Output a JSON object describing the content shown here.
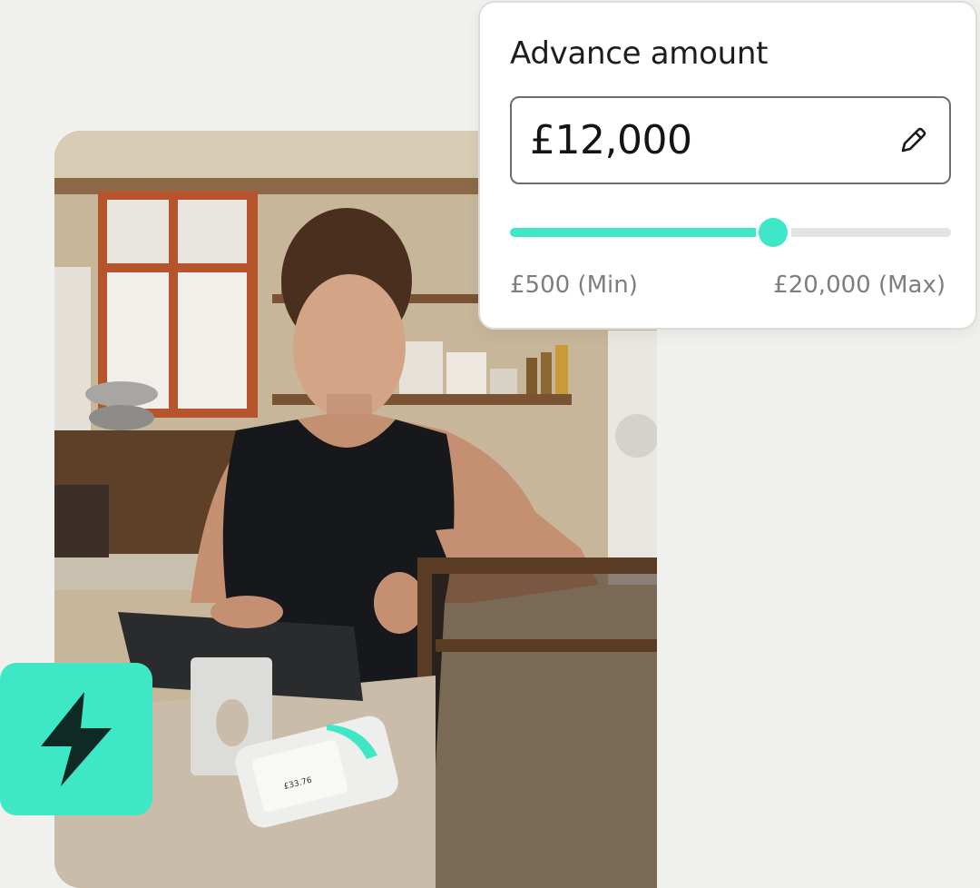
{
  "advance": {
    "title": "Advance amount",
    "amount": "£12,000",
    "min_label": "£500 (Min)",
    "max_label": "£20,000 (Max)",
    "slider_fraction": 0.58
  },
  "terminal": {
    "amount": "£33.76"
  },
  "colors": {
    "accent": "#3ee7c5",
    "icon_dark": "#0f2a24",
    "background": "#f0f0ec"
  },
  "icons": {
    "badge": "lightning-bolt-icon",
    "edit": "pencil-icon"
  }
}
